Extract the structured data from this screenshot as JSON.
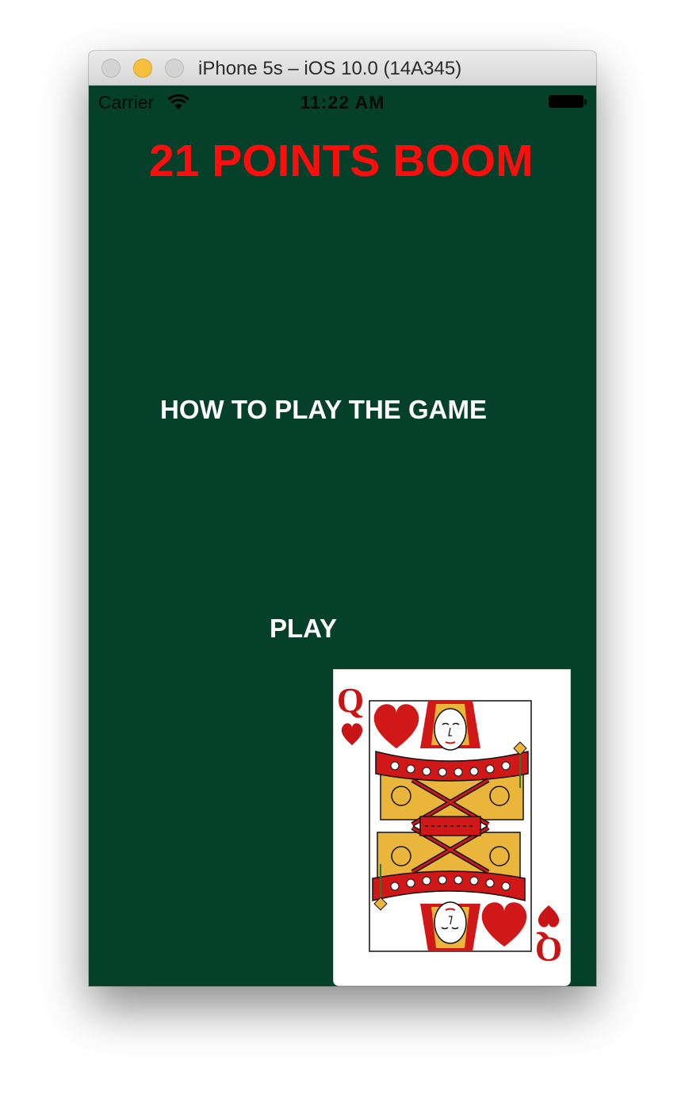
{
  "window": {
    "title": "iPhone 5s – iOS 10.0 (14A345)"
  },
  "status_bar": {
    "carrier": "Carrier",
    "time": "11:22 AM"
  },
  "app": {
    "title": "21 POINTS BOOM",
    "how_to_play_label": "HOW TO PLAY THE GAME",
    "play_label": "PLAY"
  },
  "card": {
    "rank": "Q",
    "suit": "hearts",
    "icon": "queen-of-hearts-card"
  },
  "colors": {
    "background": "#05402a",
    "title": "#ff0d0d",
    "buttons": "#ffffff",
    "card_red": "#d01818"
  }
}
